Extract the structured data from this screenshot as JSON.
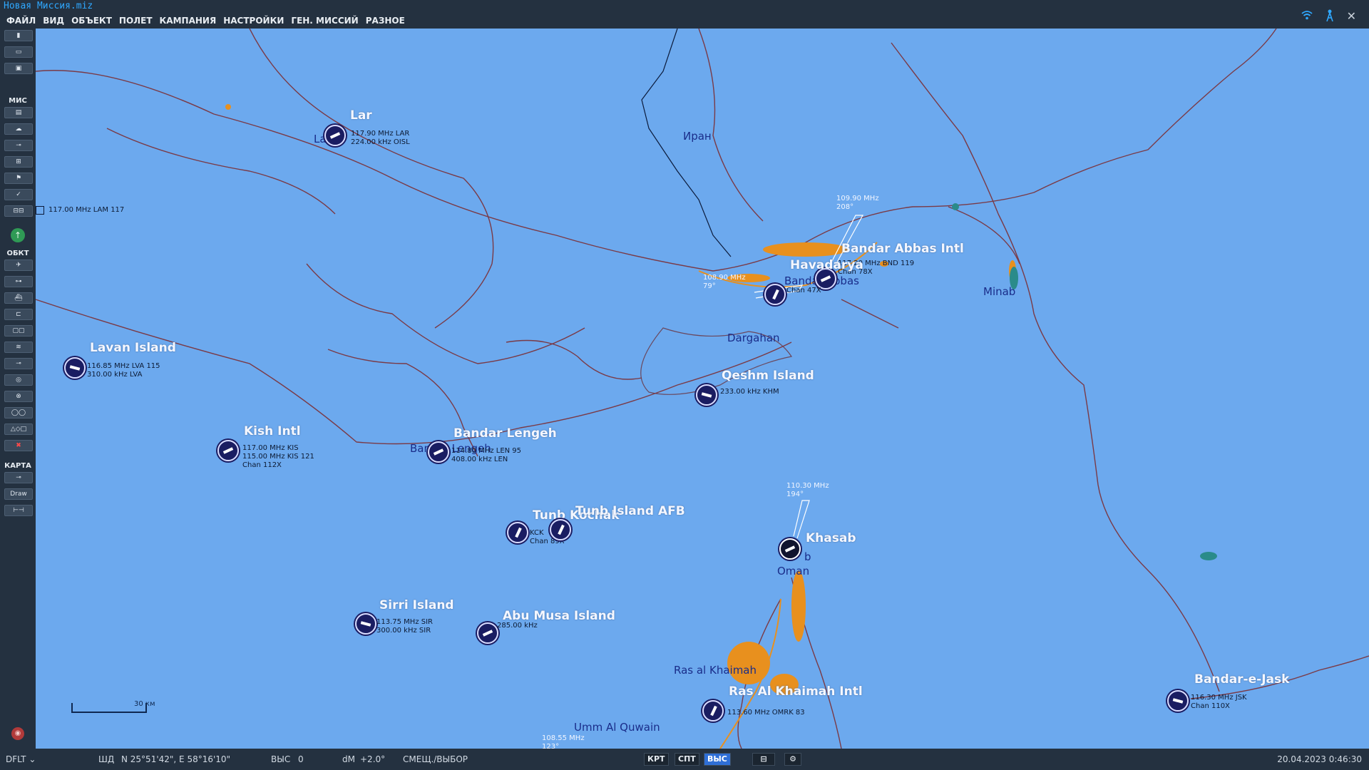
{
  "window": {
    "title": "Новая Миссия.miz",
    "icons": [
      "wifi-icon",
      "antenna-icon",
      "close-icon"
    ]
  },
  "menu": [
    "ФАЙЛ",
    "ВИД",
    "ОБЪЕКТ",
    "ПОЛЕТ",
    "КАМПАНИЯ",
    "НАСТРОЙКИ",
    "ГЕН. МИССИЙ",
    "РАЗНОЕ"
  ],
  "toolbar": {
    "sections": {
      "mission": "МИС",
      "objects": "ОБКТ",
      "map": "КАРТА"
    },
    "draw_label": "Draw"
  },
  "map": {
    "scale_label": "30 км",
    "places": [
      "Иран",
      "Minab",
      "Dargahan",
      "Oman",
      "Ras al Khaimah",
      "Umm Al Quwain",
      "Bandar Lengeh",
      "La",
      "Bandar Abbas",
      "b"
    ],
    "airbases": [
      {
        "name": "Lar",
        "info": "117.90 MHz LAR\n224.00 kHz OISL"
      },
      {
        "name": "Lavan Island",
        "info": "116.85 MHz LVA 115\n310.00 kHz LVA"
      },
      {
        "name": "Kish Intl",
        "info": "117.00 MHz KIS\n115.00 MHz KIS 121\nChan 112X"
      },
      {
        "name": "Bandar Lengeh",
        "info": "114.80 MHz LEN 95\n408.00 kHz LEN"
      },
      {
        "name": "Qeshm Island",
        "info": "233.00 kHz KHM"
      },
      {
        "name": "Bandar Abbas Intl",
        "info": "117.20 MHz BND 119\nChan 78X"
      },
      {
        "name": "Havadarya",
        "info": "Chan 47X"
      },
      {
        "name": "Tunb Kochak",
        "info": "KCK\nChan 89X"
      },
      {
        "name": "Tunb Island AFB",
        "info": ""
      },
      {
        "name": "Khasab",
        "info": ""
      },
      {
        "name": "Sirri Island",
        "info": "113.75 MHz SIR\n300.00 kHz SIR"
      },
      {
        "name": "Abu Musa Island",
        "info": "285.00 kHz"
      },
      {
        "name": "Ras Al Khaimah Intl",
        "info": "113.60 MHz OMRK 83"
      },
      {
        "name": "Bandar-e-Jask",
        "info": "116.30 MHz JSK\nChan 110X"
      }
    ],
    "nav_aids": [
      {
        "freq": "109.90 MHz",
        "bearing": "208°"
      },
      {
        "freq": "108.90 MHz",
        "bearing": "79°"
      },
      {
        "freq": "110.30 MHz",
        "bearing": "194°"
      },
      {
        "freq": "108.55 MHz",
        "bearing": "123°"
      }
    ],
    "lam": "117.00 MHz LAM 117"
  },
  "status": {
    "profile": "DFLT",
    "coord_label": "ШД",
    "coords": "N 25°51'42\", E 58°16'10\"",
    "alt_label": "ВЫС",
    "alt_value": "0",
    "dm_label": "dM",
    "dm_value": "+2.0°",
    "mode": "СМЕЩ./ВЫБОР",
    "buttons": [
      "КРТ",
      "СПТ",
      "ВЫС"
    ],
    "datetime": "20.04.2023 0:46:30"
  }
}
